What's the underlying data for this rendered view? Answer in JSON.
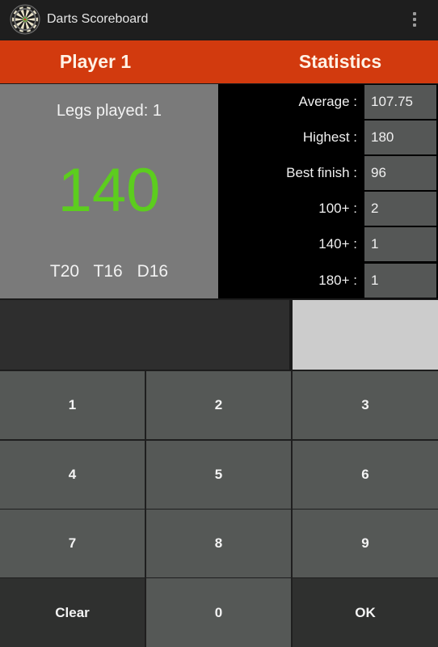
{
  "app": {
    "title": "Darts Scoreboard",
    "icon": "dartboard-icon",
    "menu_icon": "overflow-menu-icon"
  },
  "header": {
    "player_label": "Player 1",
    "stats_label": "Statistics",
    "accent_color": "#d23a0e"
  },
  "player": {
    "legs_played": "Legs played:  1",
    "remaining_score": "140",
    "score_color": "#5ccd1e",
    "checkout_suggestion": "T20 T16 D16"
  },
  "statistics": [
    {
      "label": "Average :",
      "value": "107.75"
    },
    {
      "label": "Highest :",
      "value": "180"
    },
    {
      "label": "Best finish :",
      "value": "96"
    },
    {
      "label": "100+ :",
      "value": "2"
    },
    {
      "label": "140+ :",
      "value": "1"
    },
    {
      "label": "180+ :",
      "value": "1"
    }
  ],
  "input": {
    "entered_score": ""
  },
  "keypad": [
    {
      "label": "1"
    },
    {
      "label": "2"
    },
    {
      "label": "3"
    },
    {
      "label": "4"
    },
    {
      "label": "5"
    },
    {
      "label": "6"
    },
    {
      "label": "7"
    },
    {
      "label": "8"
    },
    {
      "label": "9"
    },
    {
      "label": "Clear"
    },
    {
      "label": "0"
    },
    {
      "label": "OK"
    }
  ]
}
